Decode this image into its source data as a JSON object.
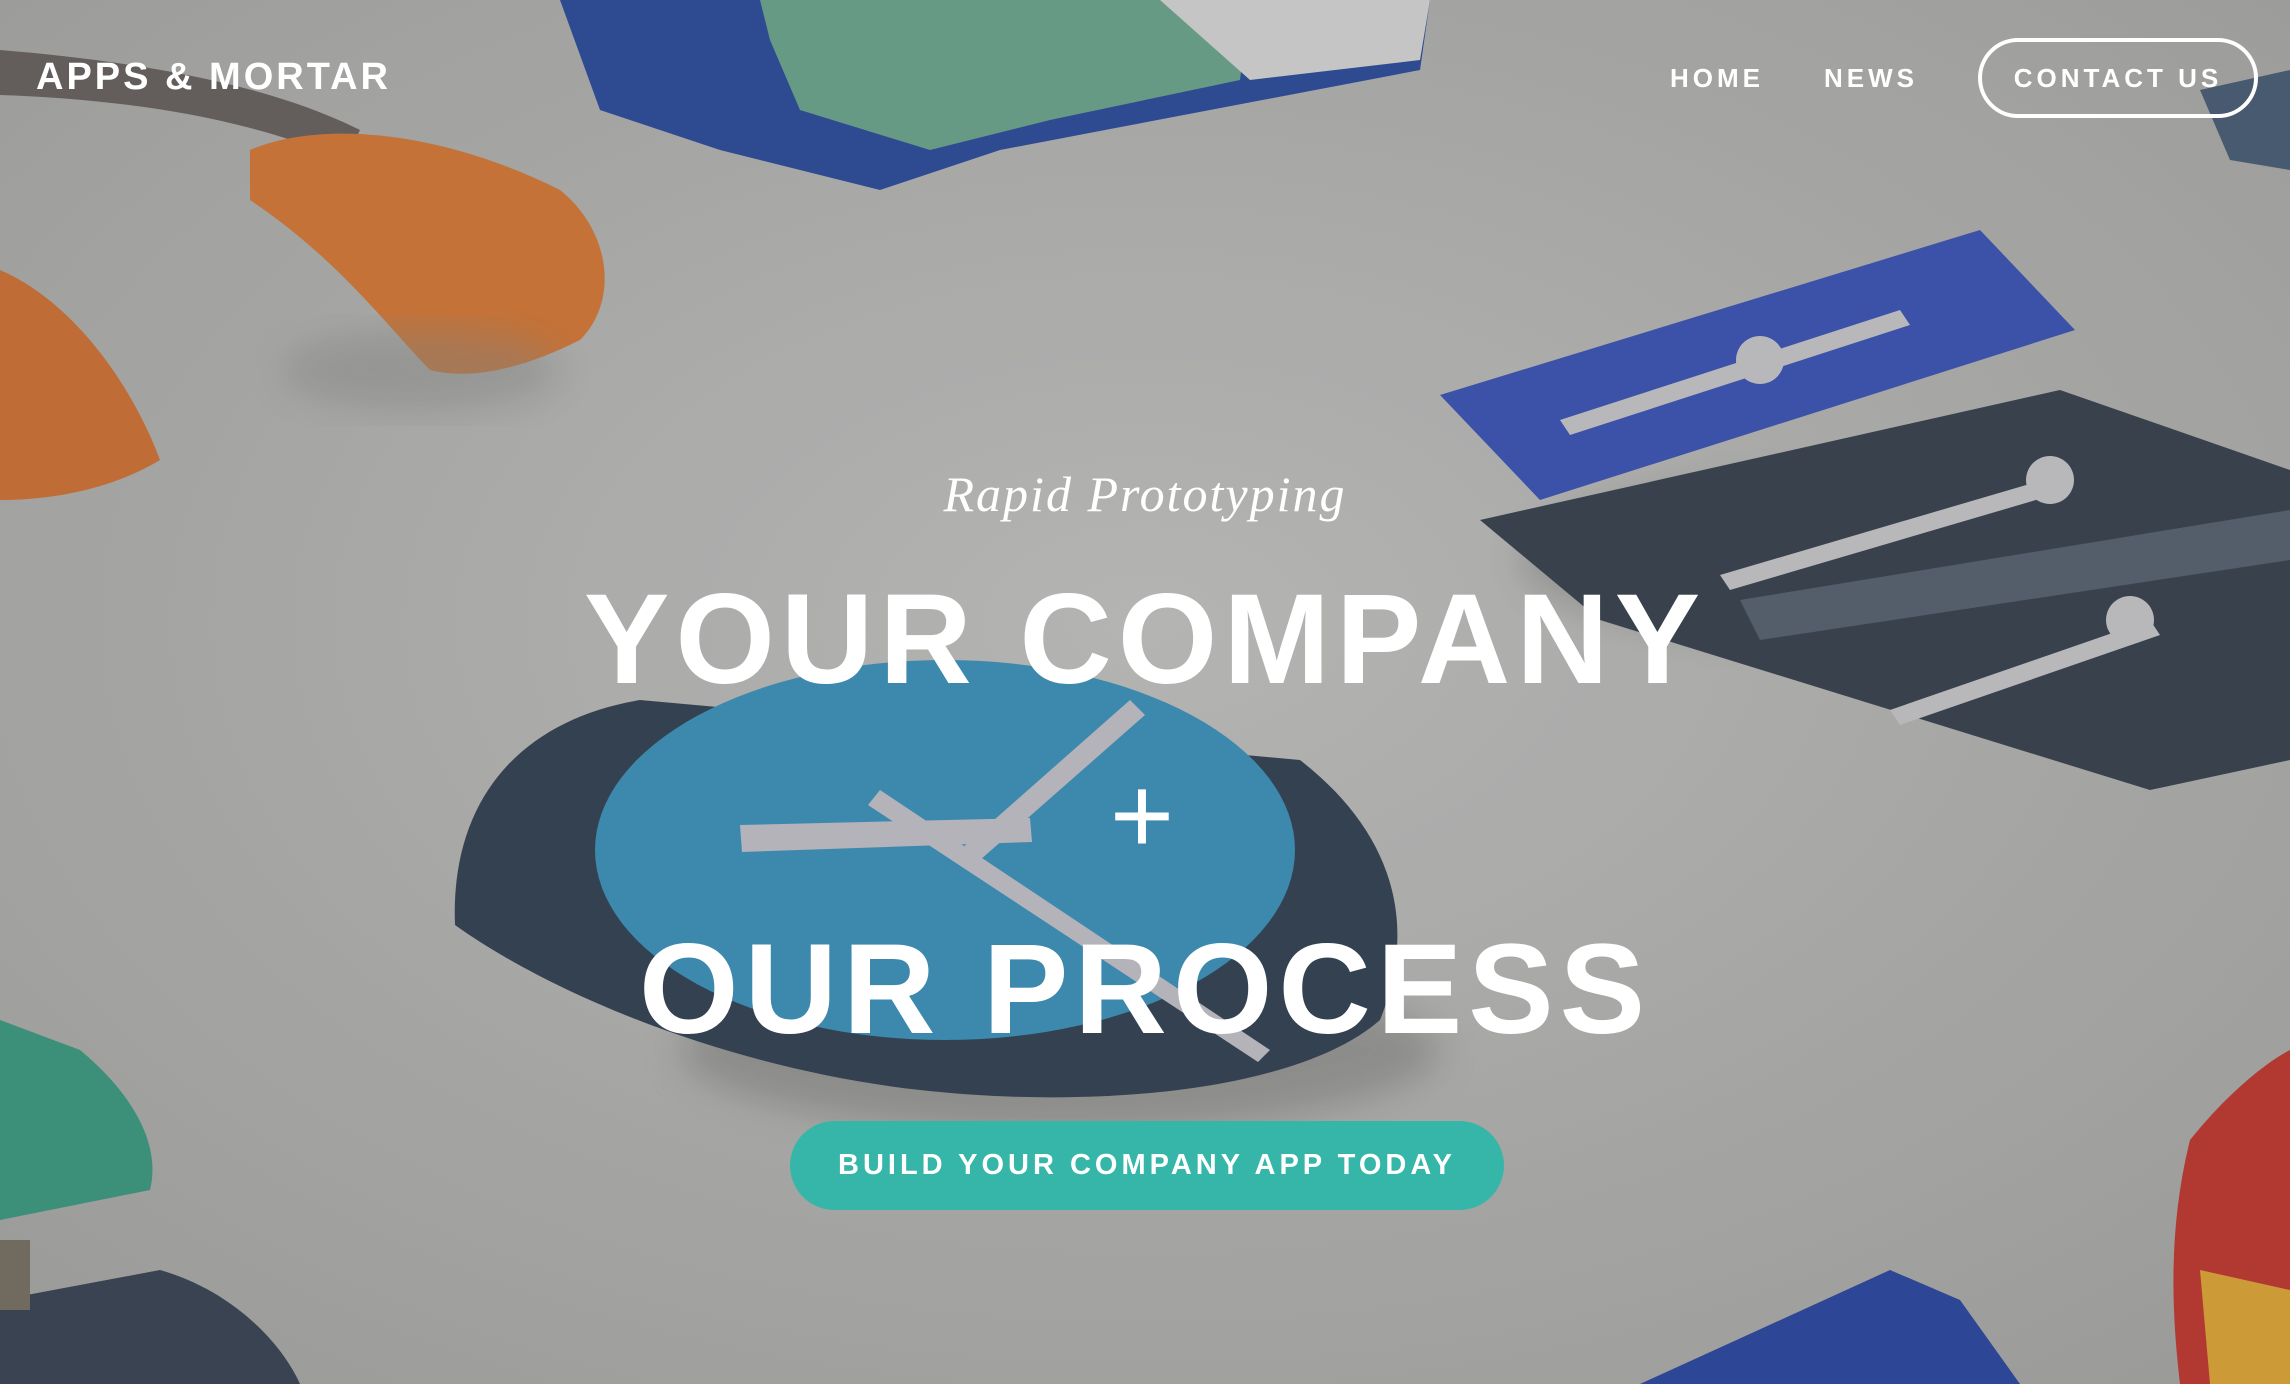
{
  "header": {
    "brand": "APPS & MORTAR",
    "nav": [
      {
        "label": "HOME"
      },
      {
        "label": "NEWS"
      }
    ],
    "contact_label": "CONTACT US"
  },
  "hero": {
    "tagline": "Rapid Prototyping",
    "headline_line1": "YOUR COMPANY",
    "headline_plus": "+",
    "headline_line2": "OUR PROCESS",
    "cta_label": "BUILD YOUR COMPANY APP TODAY"
  },
  "colors": {
    "background": "#bcbcba",
    "cta": "#36b6a8",
    "text": "#ffffff"
  }
}
